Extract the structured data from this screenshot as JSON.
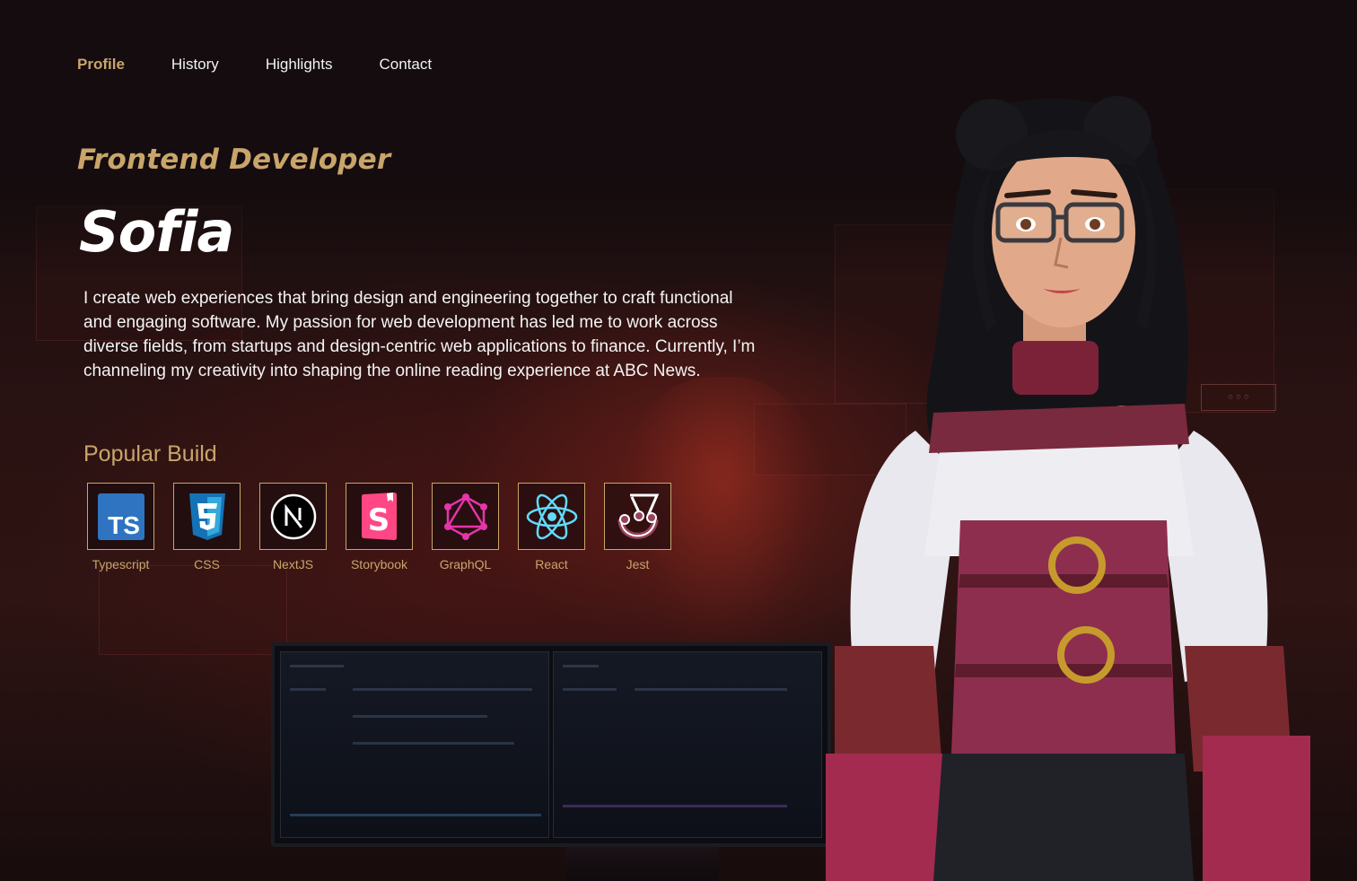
{
  "nav": {
    "items": [
      {
        "label": "Profile",
        "active": true
      },
      {
        "label": "History",
        "active": false
      },
      {
        "label": "Highlights",
        "active": false
      },
      {
        "label": "Contact",
        "active": false
      }
    ]
  },
  "hero": {
    "role": "Frontend Developer",
    "name": "Sofia",
    "bio": "I create web experiences that bring design and engineering together to craft functional and engaging software. My passion for web development has led me to work across diverse fields, from startups and design-centric web applications to finance. Currently, I’m channeling my creativity into shaping the online reading experience at ABC News."
  },
  "popular_build": {
    "title": "Popular Build",
    "items": [
      {
        "label": "Typescript",
        "icon": "typescript-icon"
      },
      {
        "label": "CSS",
        "icon": "css-icon"
      },
      {
        "label": "NextJS",
        "icon": "nextjs-icon"
      },
      {
        "label": "Storybook",
        "icon": "storybook-icon"
      },
      {
        "label": "GraphQL",
        "icon": "graphql-icon"
      },
      {
        "label": "React",
        "icon": "react-icon"
      },
      {
        "label": "Jest",
        "icon": "jest-icon"
      }
    ]
  },
  "colors": {
    "accent": "#c9a56b",
    "background": "#140c0e"
  }
}
